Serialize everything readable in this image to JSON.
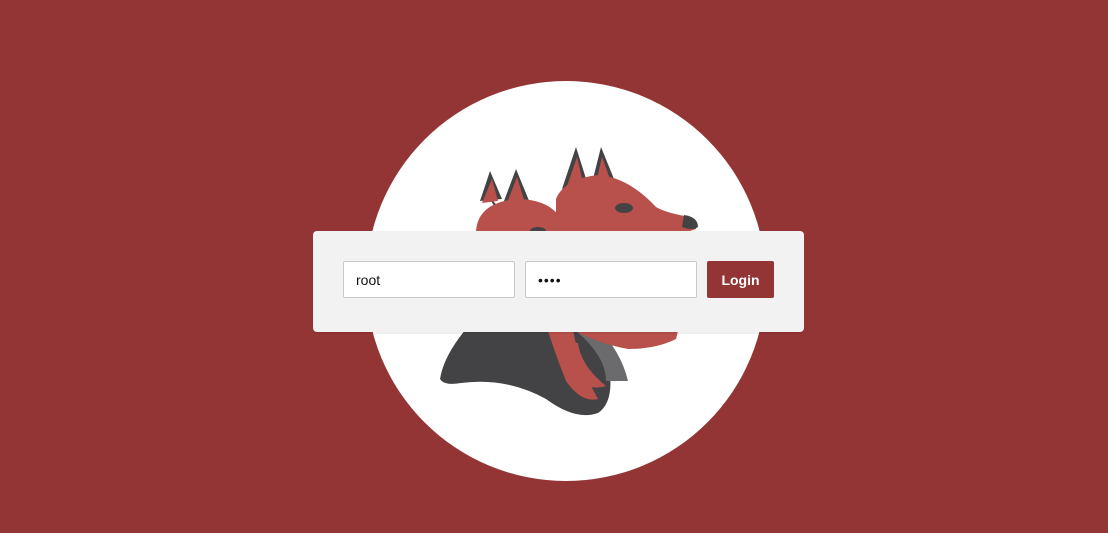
{
  "colors": {
    "background": "#943535",
    "card": "#f2f2f2",
    "button": "#943535",
    "dog_red": "#b8504b",
    "dog_dark": "#434345"
  },
  "logo": {
    "icon": "two-headed-dog-logo-icon"
  },
  "login": {
    "username_value": "root",
    "password_value": "••••",
    "button_label": "Login"
  }
}
